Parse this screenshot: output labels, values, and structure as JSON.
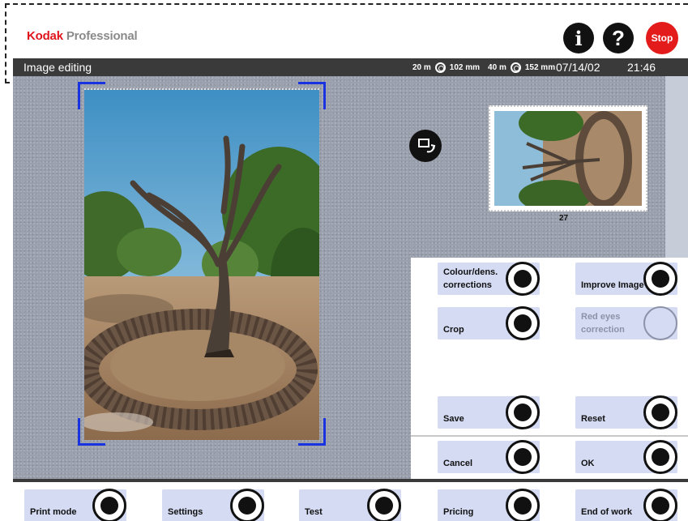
{
  "header": {
    "brand_kodak": "Kodak",
    "brand_professional": "Professional",
    "info_label": "i",
    "help_label": "?",
    "stop_label": "Stop"
  },
  "status": {
    "title": "Image editing",
    "roll1_length": "20 m",
    "roll1_width": "102 mm",
    "roll2_length": "40 m",
    "roll2_width": "152 mm",
    "date": "07/14/02",
    "time": "21:46"
  },
  "thumbnail": {
    "label": "27"
  },
  "edit_buttons": {
    "colour": "Colour/dens. corrections",
    "improve": "Improve Image",
    "crop": "Crop",
    "redeyes": "Red eyes correction",
    "save": "Save",
    "reset": "Reset",
    "cancel": "Cancel",
    "ok": "OK"
  },
  "bottom_buttons": {
    "print_mode": "Print mode",
    "settings": "Settings",
    "test": "Test",
    "pricing": "Pricing",
    "end_of_work": "End of work"
  },
  "colors": {
    "brand_red": "#e0141c",
    "button_blue": "#d4dbf2",
    "crop_marker": "#1a33e0",
    "workspace": "#9aa0ad"
  }
}
